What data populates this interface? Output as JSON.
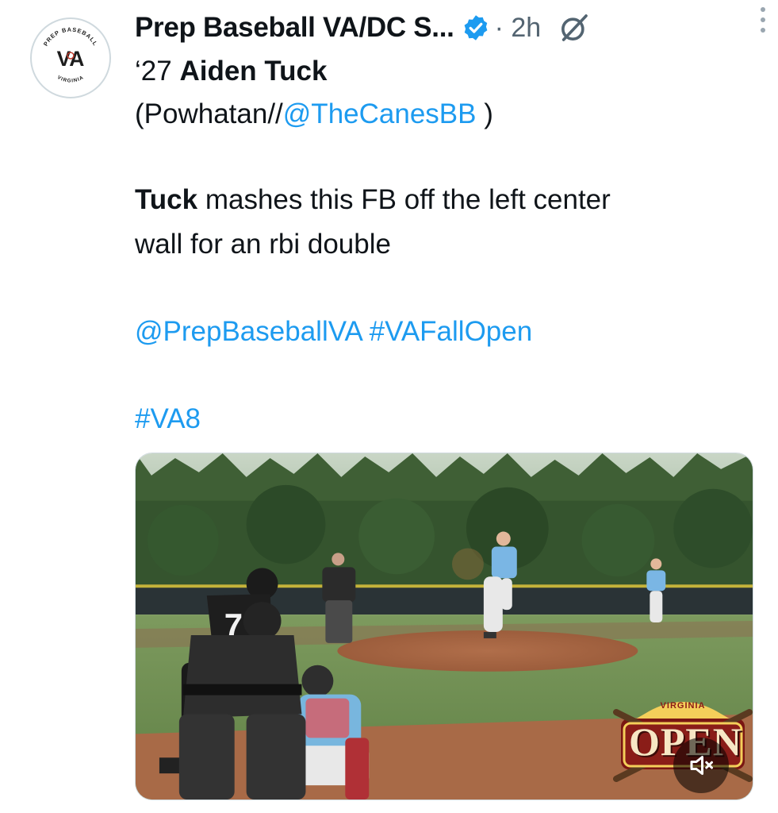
{
  "tweet": {
    "author": "Prep Baseball VA/DC S...",
    "time": "· 2h",
    "line1_prefix": "‘27 ",
    "line1_bold": "Aiden Tuck",
    "line2_prefix": "(Powhatan//",
    "line2_mention": "@TheCanesBB",
    "line2_suffix": " )",
    "line3_bold": "Tuck",
    "line3_rest": " mashes this FB off the left center",
    "line4": "wall for an rbi double",
    "tag_mention": "@PrepBaseballVA",
    "tag_hashtag": "#VAFallOpen",
    "tag_va8": "#VA8"
  },
  "avatar": {
    "top_text": "PREP BASEBALL",
    "monogram": "VA",
    "bottom_text": "VIRGINIA"
  },
  "media": {
    "jersey_number": "7",
    "badge_top": "VIRGINIA",
    "badge_main": "OPEN"
  },
  "colors": {
    "link": "#1d9bf0",
    "secondary_text": "#536471",
    "verified": "#1d9bf0"
  },
  "icons": {
    "verified": "verified-badge-icon",
    "grok": "grok-icon",
    "more": "more-icon",
    "mute": "mute-icon"
  }
}
